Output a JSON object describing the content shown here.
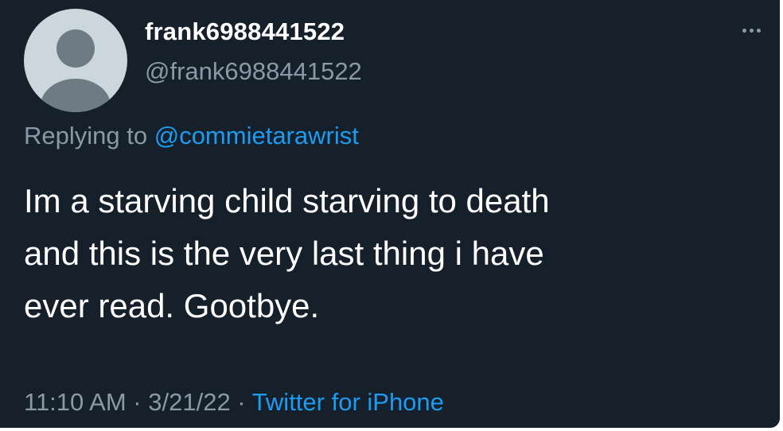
{
  "tweet": {
    "author": {
      "display_name": "frank6988441522",
      "handle": "@frank6988441522",
      "avatar_icon": "default-avatar-icon"
    },
    "menu_icon": "more-options-icon",
    "replying_prefix": "Replying to ",
    "replying_to": "@commietarawrist",
    "text": "Im a starving child starving to death\nand this is the very last thing i have\never read. Gootbye.",
    "time": "11:10 AM",
    "separator": " · ",
    "date": "3/21/22",
    "source": "Twitter for iPhone"
  },
  "colors": {
    "background": "#15202b",
    "primary_text": "#ffffff",
    "secondary_text": "#8b98a5",
    "link": "#1d9bf0",
    "avatar_bg": "#ccd6dd",
    "avatar_fg": "#6e7b85"
  }
}
